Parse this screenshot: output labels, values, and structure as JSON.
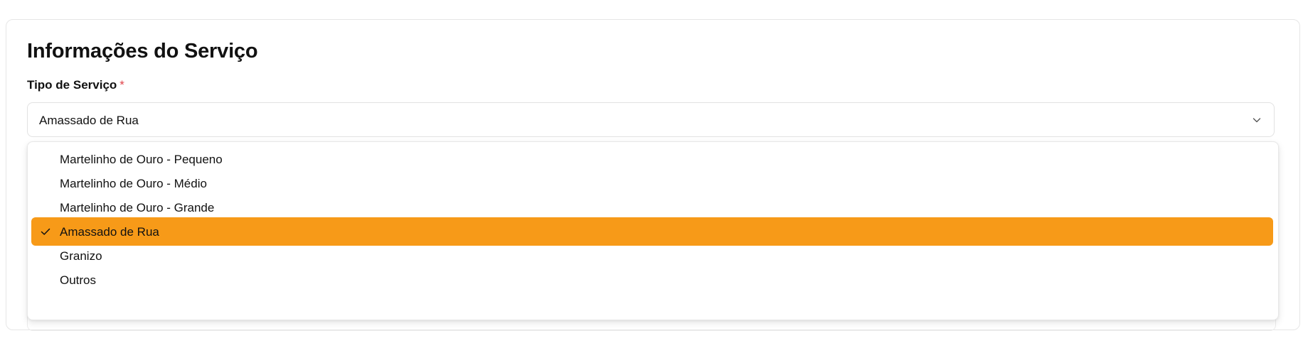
{
  "section": {
    "title": "Informações do Serviço"
  },
  "service_type_field": {
    "label": "Tipo de Serviço",
    "required_mark": "*",
    "selected_value": "Amassado de Rua",
    "options": [
      "Martelinho de Ouro - Pequeno",
      "Martelinho de Ouro - Médio",
      "Martelinho de Ouro - Grande",
      "Amassado de Rua",
      "Granizo",
      "Outros"
    ],
    "selected_index": 3
  },
  "icons": {
    "dropdown": "chevron-down-icon",
    "selected": "checkmark-icon"
  },
  "colors": {
    "accent": "#f79a18",
    "required": "#e0444b"
  }
}
